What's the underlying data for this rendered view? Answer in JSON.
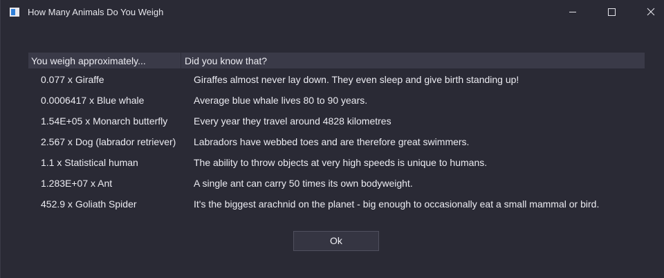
{
  "window": {
    "title": "How Many Animals Do You Weigh",
    "icon": "app-window-icon",
    "controls": [
      "minimize-icon",
      "maximize-icon",
      "close-icon"
    ]
  },
  "table": {
    "headers": {
      "weight": "You weigh approximately...",
      "fact": "Did you know that?"
    },
    "rows": [
      {
        "weight": "0.077 x Giraffe",
        "fact": "Giraffes almost never lay down. They even sleep and give birth standing up!"
      },
      {
        "weight": "0.0006417 x Blue whale",
        "fact": "Average blue whale lives 80 to 90 years."
      },
      {
        "weight": "1.54E+05 x Monarch butterfly",
        "fact": "Every year they travel around 4828 kilometres"
      },
      {
        "weight": "2.567 x Dog (labrador retriever)",
        "fact": "Labradors have webbed toes and are therefore great swimmers."
      },
      {
        "weight": "1.1 x Statistical human",
        "fact": "The ability to throw objects at very high speeds is unique to humans."
      },
      {
        "weight": "1.283E+07 x Ant",
        "fact": "A single ant can carry 50 times its own bodyweight."
      },
      {
        "weight": "452.9 x Goliath Spider",
        "fact": "It's the biggest arachnid on the planet - big enough to occasionally eat a small mammal or bird."
      }
    ]
  },
  "buttons": {
    "ok_label": "Ok"
  },
  "colors": {
    "background": "#2a2a35",
    "header_background": "#3a3a48",
    "text": "#ececf2",
    "icon_accent": "#2f7fd8"
  }
}
